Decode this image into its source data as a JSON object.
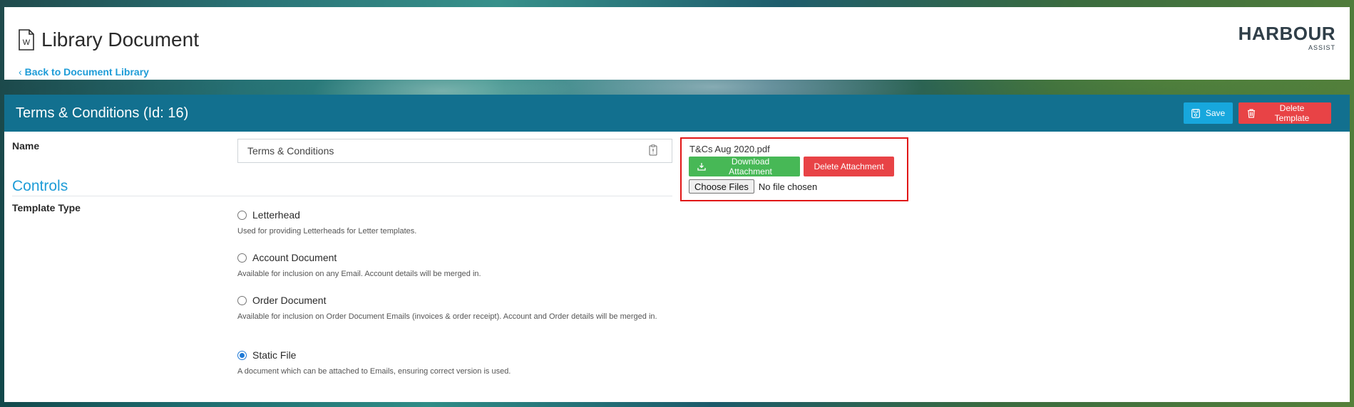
{
  "header": {
    "title": "Library Document",
    "back_link": "Back to Document Library",
    "logo_brand": "HARBOUR",
    "logo_sub": "ASSIST"
  },
  "panel": {
    "title": "Terms & Conditions (Id: 16)",
    "save_label": "Save",
    "delete_template_label": "Delete Template"
  },
  "form": {
    "name_label": "Name",
    "name_value": "Terms & Conditions",
    "controls_heading": "Controls",
    "template_type_label": "Template Type",
    "template_types": [
      {
        "label": "Letterhead",
        "description": "Used for providing Letterheads for Letter templates.",
        "selected": false
      },
      {
        "label": "Account Document",
        "description": "Available for inclusion on any Email. Account details will be merged in.",
        "selected": false
      },
      {
        "label": "Order Document",
        "description": "Available for inclusion on Order Document Emails (invoices & order receipt). Account and Order details will be merged in.",
        "selected": false
      },
      {
        "label": "Static File",
        "description": "A document which can be attached to Emails, ensuring correct version is used.",
        "selected": true
      }
    ]
  },
  "attachment": {
    "file_name": "T&Cs Aug 2020.pdf",
    "download_label": "Download Attachment",
    "delete_label": "Delete Attachment",
    "choose_label": "Choose Files",
    "no_file_text": "No file chosen"
  },
  "colors": {
    "accent": "#1e9cd7",
    "panel_header": "#12708f",
    "save": "#17a7dd",
    "danger": "#e84346",
    "success": "#47b856",
    "highlight_border": "#e11616"
  },
  "icons": [
    "document-word-icon",
    "chevron-left-icon",
    "save-icon",
    "trash-icon",
    "download-icon",
    "clipboard-icon"
  ]
}
